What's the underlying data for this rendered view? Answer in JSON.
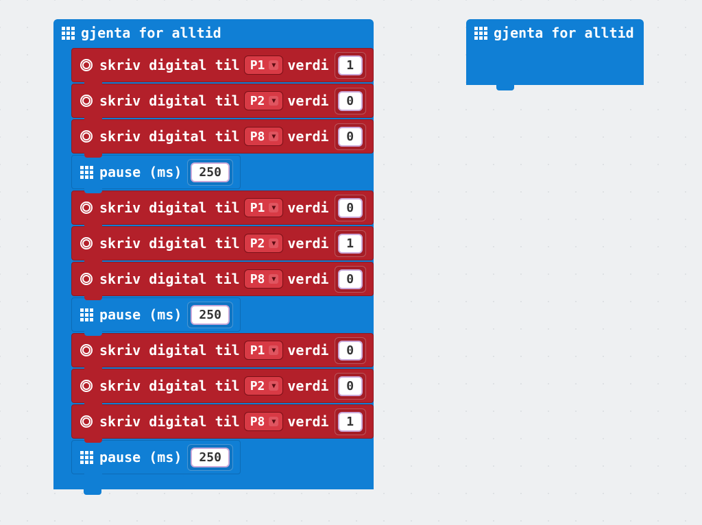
{
  "loops": {
    "forever_label": "gjenta for alltid"
  },
  "labels": {
    "write_digital_pre": "skriv digital til",
    "write_digital_post": "verdi",
    "pause": "pause (ms)"
  },
  "main_stack": {
    "blocks": [
      {
        "type": "write",
        "pin": "P1",
        "value": "1"
      },
      {
        "type": "write",
        "pin": "P2",
        "value": "0"
      },
      {
        "type": "write",
        "pin": "P8",
        "value": "0"
      },
      {
        "type": "pause",
        "ms": "250"
      },
      {
        "type": "write",
        "pin": "P1",
        "value": "0"
      },
      {
        "type": "write",
        "pin": "P2",
        "value": "1"
      },
      {
        "type": "write",
        "pin": "P8",
        "value": "0"
      },
      {
        "type": "pause",
        "ms": "250"
      },
      {
        "type": "write",
        "pin": "P1",
        "value": "0"
      },
      {
        "type": "write",
        "pin": "P2",
        "value": "0"
      },
      {
        "type": "write",
        "pin": "P8",
        "value": "1"
      },
      {
        "type": "pause",
        "ms": "250"
      }
    ]
  }
}
